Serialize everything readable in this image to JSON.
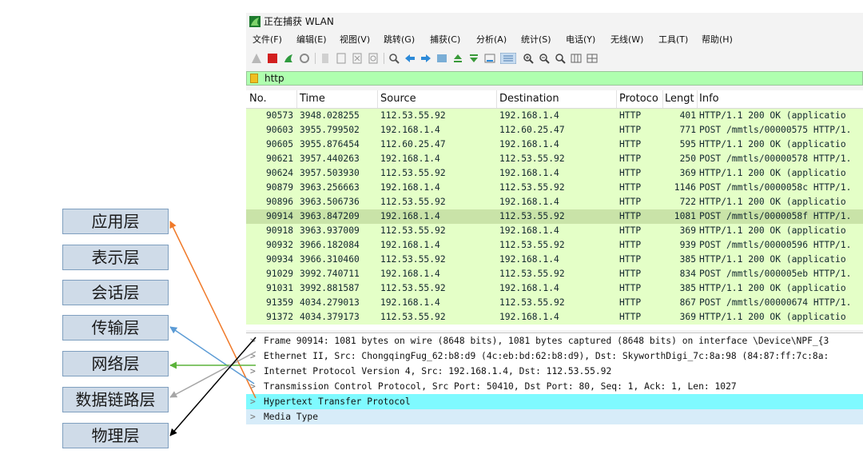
{
  "window": {
    "title": "正在捕获 WLAN"
  },
  "menu": [
    "文件(F)",
    "编辑(E)",
    "视图(V)",
    "跳转(G)",
    "捕获(C)",
    "分析(A)",
    "统计(S)",
    "电话(Y)",
    "无线(W)",
    "工具(T)",
    "帮助(H)"
  ],
  "filter": {
    "value": "http"
  },
  "columns": {
    "no": "No.",
    "time": "Time",
    "source": "Source",
    "destination": "Destination",
    "protocol": "Protoco",
    "length": "Lengt",
    "info": "Info"
  },
  "packets": [
    {
      "no": "90573",
      "time": "3948.028255",
      "src": "112.53.55.92",
      "dst": "192.168.1.4",
      "proto": "HTTP",
      "len": "401",
      "info": "HTTP/1.1 200 OK  (applicatio"
    },
    {
      "no": "90603",
      "time": "3955.799502",
      "src": "192.168.1.4",
      "dst": "112.60.25.47",
      "proto": "HTTP",
      "len": "771",
      "info": "POST /mmtls/00000575 HTTP/1."
    },
    {
      "no": "90605",
      "time": "3955.876454",
      "src": "112.60.25.47",
      "dst": "192.168.1.4",
      "proto": "HTTP",
      "len": "595",
      "info": "HTTP/1.1 200 OK  (applicatio"
    },
    {
      "no": "90621",
      "time": "3957.440263",
      "src": "192.168.1.4",
      "dst": "112.53.55.92",
      "proto": "HTTP",
      "len": "250",
      "info": "POST /mmtls/00000578 HTTP/1."
    },
    {
      "no": "90624",
      "time": "3957.503930",
      "src": "112.53.55.92",
      "dst": "192.168.1.4",
      "proto": "HTTP",
      "len": "369",
      "info": "HTTP/1.1 200 OK  (applicatio"
    },
    {
      "no": "90879",
      "time": "3963.256663",
      "src": "192.168.1.4",
      "dst": "112.53.55.92",
      "proto": "HTTP",
      "len": "1146",
      "info": "POST /mmtls/0000058c HTTP/1."
    },
    {
      "no": "90896",
      "time": "3963.506736",
      "src": "112.53.55.92",
      "dst": "192.168.1.4",
      "proto": "HTTP",
      "len": "722",
      "info": "HTTP/1.1 200 OK  (applicatio"
    },
    {
      "no": "90914",
      "time": "3963.847209",
      "src": "192.168.1.4",
      "dst": "112.53.55.92",
      "proto": "HTTP",
      "len": "1081",
      "info": "POST /mmtls/0000058f HTTP/1."
    },
    {
      "no": "90918",
      "time": "3963.937009",
      "src": "112.53.55.92",
      "dst": "192.168.1.4",
      "proto": "HTTP",
      "len": "369",
      "info": "HTTP/1.1 200 OK  (applicatio"
    },
    {
      "no": "90932",
      "time": "3966.182084",
      "src": "192.168.1.4",
      "dst": "112.53.55.92",
      "proto": "HTTP",
      "len": "939",
      "info": "POST /mmtls/00000596 HTTP/1."
    },
    {
      "no": "90934",
      "time": "3966.310460",
      "src": "112.53.55.92",
      "dst": "192.168.1.4",
      "proto": "HTTP",
      "len": "385",
      "info": "HTTP/1.1 200 OK  (applicatio"
    },
    {
      "no": "91029",
      "time": "3992.740711",
      "src": "192.168.1.4",
      "dst": "112.53.55.92",
      "proto": "HTTP",
      "len": "834",
      "info": "POST /mmtls/000005eb HTTP/1."
    },
    {
      "no": "91031",
      "time": "3992.881587",
      "src": "112.53.55.92",
      "dst": "192.168.1.4",
      "proto": "HTTP",
      "len": "385",
      "info": "HTTP/1.1 200 OK  (applicatio"
    },
    {
      "no": "91359",
      "time": "4034.279013",
      "src": "192.168.1.4",
      "dst": "112.53.55.92",
      "proto": "HTTP",
      "len": "867",
      "info": "POST /mmtls/00000674 HTTP/1."
    },
    {
      "no": "91372",
      "time": "4034.379173",
      "src": "112.53.55.92",
      "dst": "192.168.1.4",
      "proto": "HTTP",
      "len": "369",
      "info": "HTTP/1.1 200 OK  (applicatio"
    }
  ],
  "details": [
    "Frame 90914: 1081 bytes on wire (8648 bits), 1081 bytes captured (8648 bits) on interface \\Device\\NPF_{3",
    "Ethernet II, Src: ChongqingFug_62:b8:d9 (4c:eb:bd:62:b8:d9), Dst: SkyworthDigi_7c:8a:98 (84:87:ff:7c:8a:",
    "Internet Protocol Version 4, Src: 192.168.1.4, Dst: 112.53.55.92",
    "Transmission Control Protocol, Src Port: 50410, Dst Port: 80, Seq: 1, Ack: 1, Len: 1027",
    "Hypertext Transfer Protocol",
    "Media Type"
  ],
  "osi_layers": [
    "应用层",
    "表示层",
    "会话层",
    "传输层",
    "网络层",
    "数据链路层",
    "物理层"
  ],
  "colors": {
    "application_arrow": "#f07a2a",
    "transport_arrow": "#5b9bd5",
    "network_arrow": "#5bb33a",
    "datalink_arrow": "#a6a6a6",
    "physical_arrow": "#000000"
  }
}
